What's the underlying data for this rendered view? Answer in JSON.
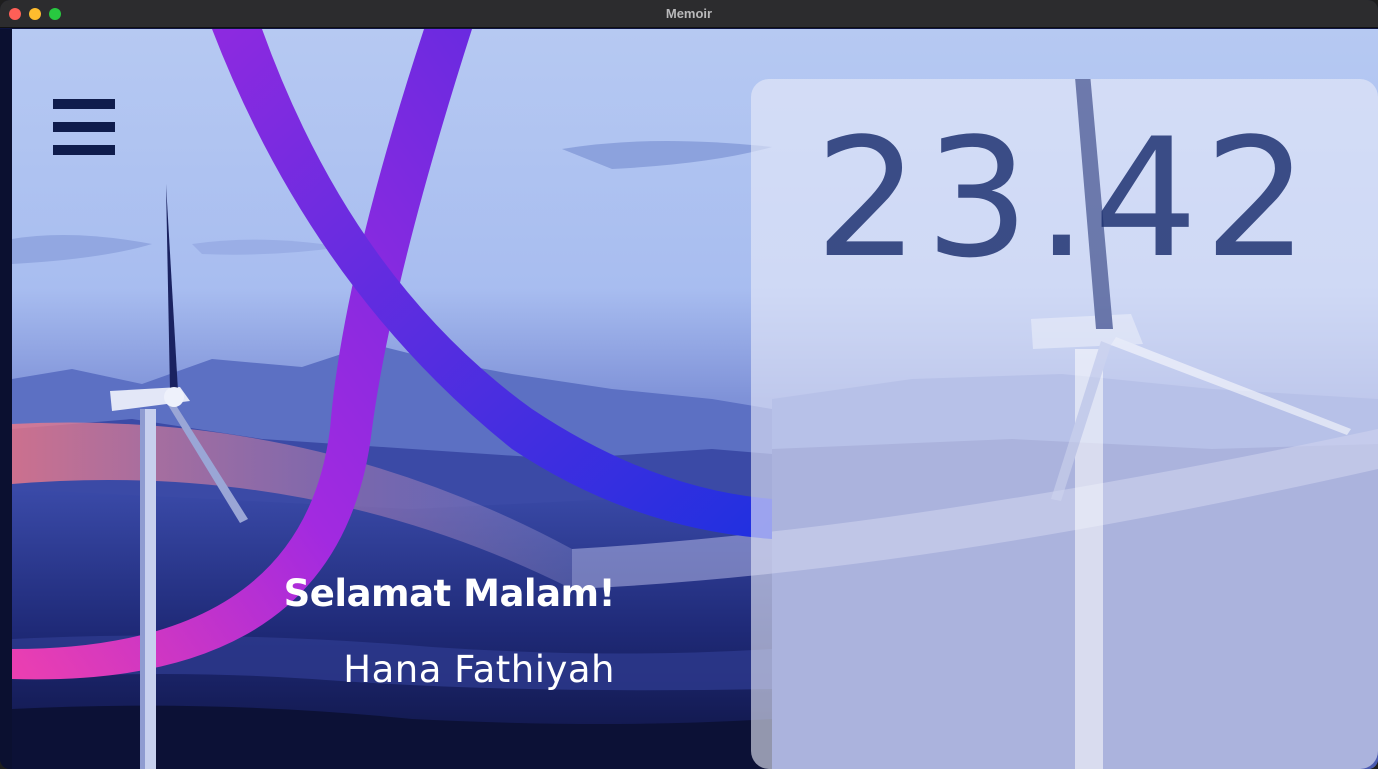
{
  "window": {
    "title": "Memoir"
  },
  "icons": {
    "menu": "hamburger-menu-icon",
    "close": "close-dot",
    "minimize": "minimize-dot",
    "maximize": "maximize-dot"
  },
  "clock": {
    "time": "23.42"
  },
  "greeting": {
    "salutation": "Selamat Malam!",
    "user_name": "Hana Fathiyah"
  },
  "colors": {
    "ribbon_start": "#e93fb3",
    "ribbon_mid": "#a326e0",
    "ribbon_end": "#2f2fe0",
    "clock_text": "#182c6c",
    "menu_icon": "#0f1c4c",
    "sky_top": "#b9cbf3",
    "ground_dark": "#0f1543"
  }
}
